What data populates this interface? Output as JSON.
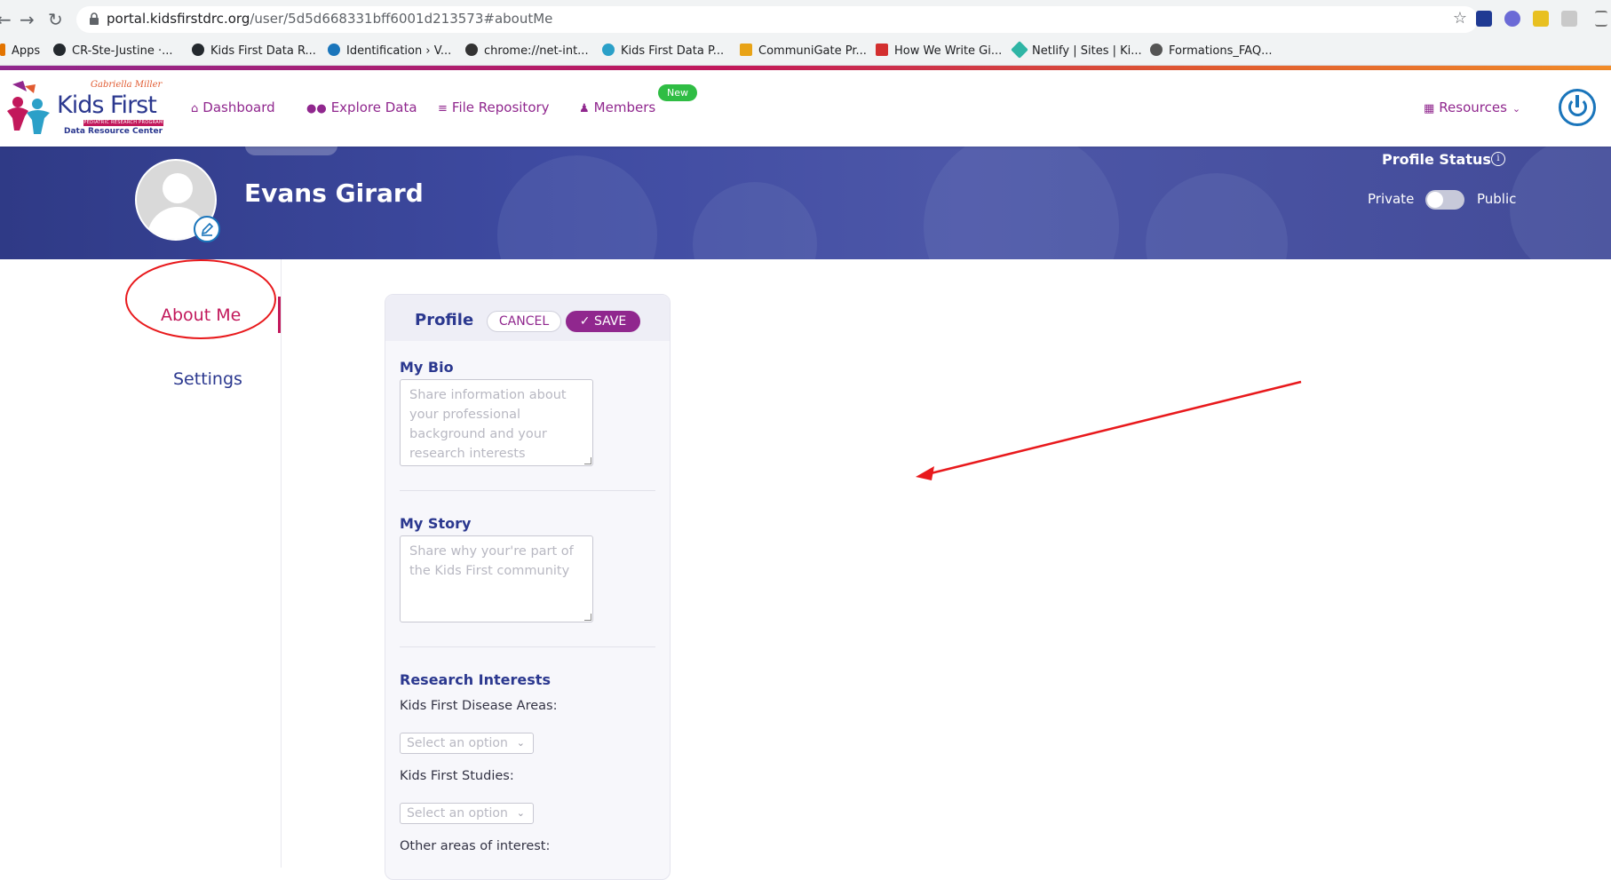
{
  "browser": {
    "url_host": "portal.kidsfirstdrc.org",
    "url_path": "/user/5d5d668331bff6001d213573#aboutMe",
    "bookmarks": [
      {
        "label": "Apps",
        "color": "#e37400"
      },
      {
        "label": "CR-Ste-Justine ·...",
        "color": "#24292e"
      },
      {
        "label": "Kids First Data R...",
        "color": "#24292e"
      },
      {
        "label": "Identification › V...",
        "color": "#1a75bb"
      },
      {
        "label": "chrome://net-int...",
        "color": "#333333"
      },
      {
        "label": "Kids First Data P...",
        "color": "#2ba0c8"
      },
      {
        "label": "CommuniGate Pr...",
        "color": "#e8a317"
      },
      {
        "label": "How We Write Gi...",
        "color": "#d32f2f"
      },
      {
        "label": "Netlify | Sites | Ki...",
        "color": "#2fb5a5"
      },
      {
        "label": "Formations_FAQ...",
        "color": "#555555"
      }
    ]
  },
  "header": {
    "logo_tagline": "Gabriella Miller",
    "logo_name": "Kids First",
    "logo_strip": "PEDIATRIC RESEARCH PROGRAM",
    "logo_subtitle": "Data Resource Center",
    "nav": [
      {
        "label": "Dashboard",
        "icon": "home-icon"
      },
      {
        "label": "Explore Data",
        "icon": "users-icon"
      },
      {
        "label": "File Repository",
        "icon": "database-icon"
      },
      {
        "label": "Members",
        "icon": "user-icon"
      }
    ],
    "new_badge": "New",
    "resources": "Resources"
  },
  "profile": {
    "name": "Evans Girard",
    "status_title": "Profile Status",
    "private_label": "Private",
    "public_label": "Public",
    "is_public": false
  },
  "sidebar": {
    "items": [
      {
        "label": "About Me",
        "active": true
      },
      {
        "label": "Settings",
        "active": false
      }
    ]
  },
  "card": {
    "title": "Profile",
    "cancel_label": "CANCEL",
    "save_label": "SAVE",
    "bio_title": "My Bio",
    "bio_placeholder": "Share information about your professional background and your research interests",
    "story_title": "My Story",
    "story_placeholder": "Share why your're part of the Kids First community",
    "interests_title": "Research Interests",
    "disease_label": "Kids First Disease Areas:",
    "disease_placeholder": "Select an option",
    "studies_label": "Kids First Studies:",
    "studies_placeholder": "Select an option",
    "other_label": "Other areas of interest:"
  },
  "colors": {
    "brand_purple": "#90278e",
    "brand_pink": "#c2185b",
    "brand_navy": "#2b388f",
    "annotation_red": "#e8191c"
  }
}
